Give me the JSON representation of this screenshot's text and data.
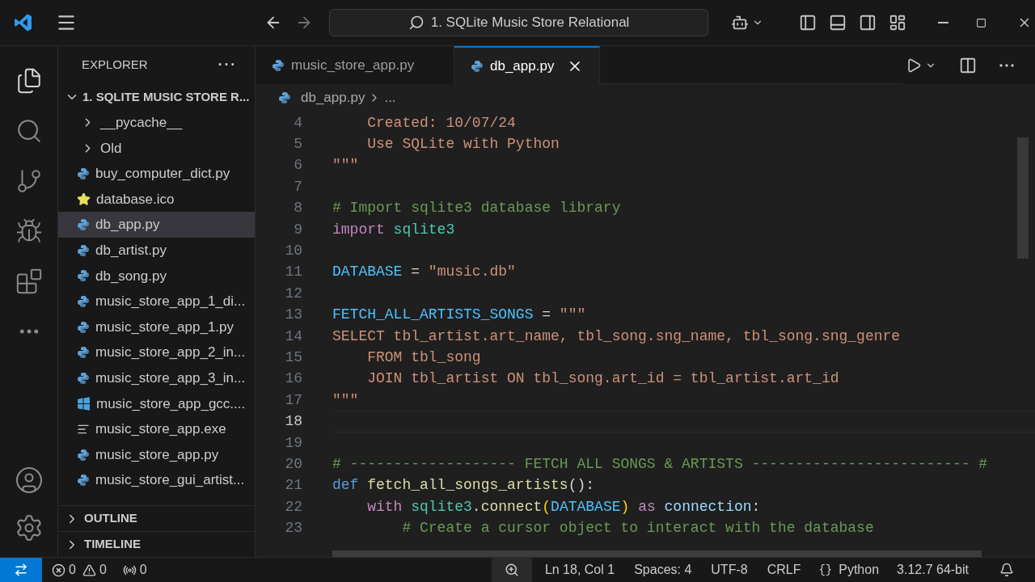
{
  "title_bar": {
    "search": "1. SQLite Music Store Relational"
  },
  "explorer": {
    "title": "EXPLORER",
    "more": "···",
    "root": {
      "label": "1. SQLITE MUSIC STORE R...",
      "expanded": true
    },
    "items": [
      {
        "name": "__pycache__",
        "kind": "folder",
        "expanded": false,
        "selected": false
      },
      {
        "name": "Old",
        "kind": "folder",
        "expanded": false,
        "selected": false
      },
      {
        "name": "buy_computer_dict.py",
        "kind": "python",
        "selected": false
      },
      {
        "name": "database.ico",
        "kind": "star",
        "selected": false
      },
      {
        "name": "db_app.py",
        "kind": "python",
        "selected": true
      },
      {
        "name": "db_artist.py",
        "kind": "python",
        "selected": false
      },
      {
        "name": "db_song.py",
        "kind": "python",
        "selected": false
      },
      {
        "name": "music_store_app_1_di...",
        "kind": "python",
        "selected": false
      },
      {
        "name": "music_store_app_1.py",
        "kind": "python",
        "selected": false
      },
      {
        "name": "music_store_app_2_in...",
        "kind": "python",
        "selected": false
      },
      {
        "name": "music_store_app_3_in...",
        "kind": "python",
        "selected": false
      },
      {
        "name": "music_store_app_gcc....",
        "kind": "windows",
        "selected": false
      },
      {
        "name": "music_store_app.exe",
        "kind": "text",
        "selected": false
      },
      {
        "name": "music_store_app.py",
        "kind": "python",
        "selected": false
      },
      {
        "name": "music_store_gui_artist...",
        "kind": "python",
        "selected": false
      }
    ],
    "sections": [
      {
        "label": "OUTLINE",
        "expanded": false
      },
      {
        "label": "TIMELINE",
        "expanded": false
      }
    ]
  },
  "tabs": [
    {
      "label": "music_store_app.py",
      "selected": false
    },
    {
      "label": "db_app.py",
      "selected": true
    }
  ],
  "breadcrumb": [
    "db_app.py",
    "..."
  ],
  "editor": {
    "lines": [
      {
        "number": "4",
        "current": false,
        "tokens": [
          {
            "text": "    Created: 10/07/24",
            "kind": "string"
          }
        ]
      },
      {
        "number": "5",
        "current": false,
        "tokens": [
          {
            "text": "    Use SQLite with Python",
            "kind": "string"
          }
        ]
      },
      {
        "number": "6",
        "current": false,
        "tokens": [
          {
            "text": "\"\"\"",
            "kind": "string"
          }
        ]
      },
      {
        "number": "7",
        "current": false
      },
      {
        "number": "8",
        "current": false,
        "tokens": [
          {
            "text": "# Import sqlite3 database library",
            "kind": "comment"
          }
        ]
      },
      {
        "number": "9",
        "current": false,
        "tokens": [
          {
            "text": "import",
            "kind": "control"
          },
          {
            "text": " sqlite3",
            "kind": "module"
          }
        ]
      },
      {
        "number": "10",
        "current": false
      },
      {
        "number": "11",
        "current": false,
        "tokens": [
          {
            "text": "DATABASE",
            "kind": "constant"
          },
          {
            "text": " = ",
            "kind": "plain"
          },
          {
            "text": "\"music.db\"",
            "kind": "string"
          }
        ]
      },
      {
        "number": "12",
        "current": false
      },
      {
        "number": "13",
        "current": false,
        "tokens": [
          {
            "text": "FETCH_ALL_ARTISTS_SONGS",
            "kind": "constant"
          },
          {
            "text": " = ",
            "kind": "plain"
          },
          {
            "text": "\"\"\"",
            "kind": "string"
          }
        ]
      },
      {
        "number": "14",
        "current": false,
        "tokens": [
          {
            "text": "SELECT tbl_artist.art_name, tbl_song.sng_name, tbl_song.sng_genre",
            "kind": "string"
          }
        ]
      },
      {
        "number": "15",
        "current": false,
        "tokens": [
          {
            "text": "    FROM tbl_song",
            "kind": "string"
          }
        ]
      },
      {
        "number": "16",
        "current": false,
        "tokens": [
          {
            "text": "    JOIN tbl_artist ON tbl_song.art_id = tbl_artist.art_id",
            "kind": "string"
          }
        ]
      },
      {
        "number": "17",
        "current": false,
        "tokens": [
          {
            "text": "\"\"\"",
            "kind": "string"
          }
        ]
      },
      {
        "number": "18",
        "current": true
      },
      {
        "number": "19",
        "current": false
      },
      {
        "number": "20",
        "current": false,
        "tokens": [
          {
            "text": "# ------------------- FETCH ALL SONGS & ARTISTS ------------------------- #",
            "kind": "comment"
          }
        ]
      },
      {
        "number": "21",
        "current": false,
        "tokens": [
          {
            "text": "def",
            "kind": "keyword"
          },
          {
            "text": " fetch_all_songs_artists",
            "kind": "function"
          },
          {
            "text": "():",
            "kind": "plain"
          }
        ]
      },
      {
        "number": "22",
        "current": false,
        "tokens": [
          {
            "text": "    with",
            "kind": "control"
          },
          {
            "text": " sqlite3",
            "kind": "module"
          },
          {
            "text": ".",
            "kind": "plain"
          },
          {
            "text": "connect",
            "kind": "function"
          },
          {
            "text": "(",
            "kind": "bracket"
          },
          {
            "text": "DATABASE",
            "kind": "constant"
          },
          {
            "text": ")",
            "kind": "bracket"
          },
          {
            "text": " as",
            "kind": "control"
          },
          {
            "text": " connection",
            "kind": "variable"
          },
          {
            "text": ":",
            "kind": "plain"
          }
        ]
      },
      {
        "number": "23",
        "current": false,
        "tokens": [
          {
            "text": "        # Create a cursor object to interact with the database",
            "kind": "comment"
          }
        ]
      }
    ]
  },
  "status_bar": {
    "errors": "0",
    "warnings": "0",
    "ports": "0",
    "position": "Ln 18, Col 1",
    "spaces": "Spaces: 4",
    "encoding": "UTF-8",
    "eol": "CRLF",
    "braces": "{}",
    "language": "Python",
    "interpreter": "3.12.7 64-bit"
  }
}
